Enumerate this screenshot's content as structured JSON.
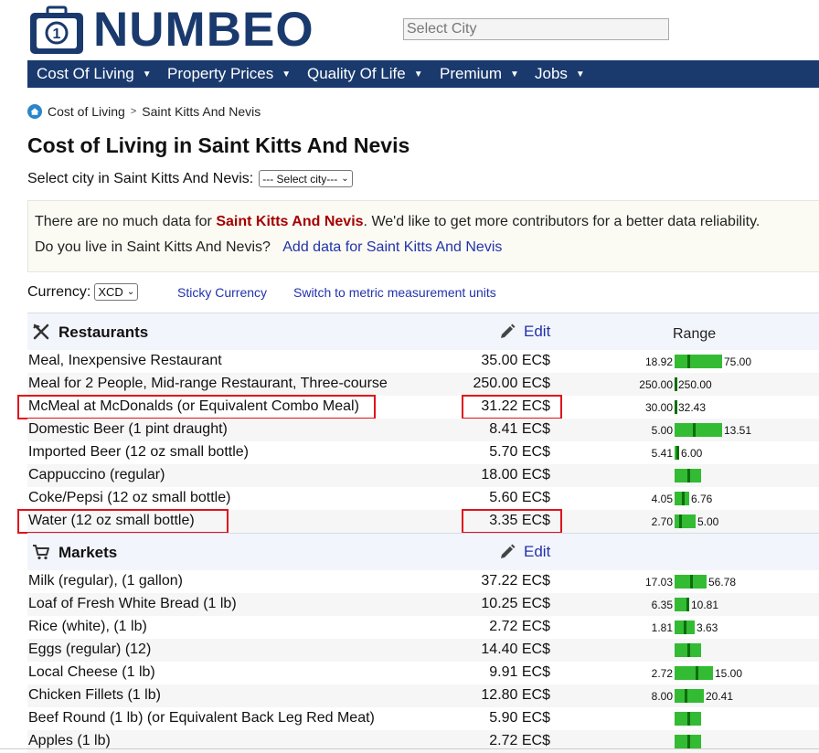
{
  "header": {
    "logo_text": "NUMBEO",
    "search_placeholder": "Select City",
    "nav": [
      {
        "label": "Cost Of Living"
      },
      {
        "label": "Property Prices"
      },
      {
        "label": "Quality Of Life"
      },
      {
        "label": "Premium"
      },
      {
        "label": "Jobs"
      }
    ]
  },
  "breadcrumb": {
    "root": "Cost of Living",
    "separator": ">",
    "current": "Saint Kitts And Nevis"
  },
  "page": {
    "title": "Cost of Living in Saint Kitts And Nevis",
    "select_city_label": "Select city in Saint Kitts And Nevis:",
    "select_city_value": "--- Select city---"
  },
  "notice": {
    "line1_prefix": "There are no much data for ",
    "line1_country": "Saint Kitts And Nevis",
    "line1_suffix": ". We'd like to get more contributors for a better data reliability.",
    "line2_prefix": "Do you live in Saint Kitts And Nevis?",
    "line2_link": "Add data for Saint Kitts And Nevis"
  },
  "currency": {
    "label": "Currency:",
    "value": "XCD",
    "sticky_link": "Sticky Currency",
    "metric_link": "Switch to metric measurement units"
  },
  "colors": {
    "nav_bg": "#1a3a6e",
    "bar": "#33bb33",
    "bar_tick": "#0b6e0b",
    "highlight": "#e0131c",
    "link": "#2233aa"
  },
  "categories": [
    {
      "name": "Restaurants",
      "icon": "fork-knife-icon",
      "edit_label": "Edit",
      "range_label": "Range",
      "rows": [
        {
          "item": "Meal, Inexpensive Restaurant",
          "price": "35.00 EC$",
          "min": "18.92",
          "max": "75.00",
          "bar_fraction": 0.45,
          "tick_fraction": 0.28
        },
        {
          "item": "Meal for 2 People, Mid-range Restaurant, Three-course",
          "price": "250.00 EC$",
          "min": "250.00",
          "max": "250.00",
          "bar_fraction": 0.02,
          "tick_fraction": 0.5
        },
        {
          "item": "McMeal at McDonalds (or Equivalent Combo Meal)",
          "price": "31.22 EC$",
          "min": "30.00",
          "max": "32.43",
          "bar_fraction": 0.02,
          "tick_fraction": 0.5,
          "highlight": true
        },
        {
          "item": "Domestic Beer (1 pint draught)",
          "price": "8.41 EC$",
          "min": "5.00",
          "max": "13.51",
          "bar_fraction": 0.45,
          "tick_fraction": 0.4
        },
        {
          "item": "Imported Beer (12 oz small bottle)",
          "price": "5.70 EC$",
          "min": "5.41",
          "max": "6.00",
          "bar_fraction": 0.04,
          "tick_fraction": 0.5
        },
        {
          "item": "Cappuccino (regular)",
          "price": "18.00 EC$",
          "min": "",
          "max": "",
          "bar_fraction": 0.25,
          "tick_fraction": 0.5
        },
        {
          "item": "Coke/Pepsi (12 oz small bottle)",
          "price": "5.60 EC$",
          "min": "4.05",
          "max": "6.76",
          "bar_fraction": 0.14,
          "tick_fraction": 0.57
        },
        {
          "item": "Water (12 oz small bottle)",
          "price": "3.35 EC$",
          "min": "2.70",
          "max": "5.00",
          "bar_fraction": 0.2,
          "tick_fraction": 0.28,
          "highlight": true
        }
      ]
    },
    {
      "name": "Markets",
      "icon": "shopping-cart-icon",
      "edit_label": "Edit",
      "range_label": "",
      "rows": [
        {
          "item": "Milk (regular), (1 gallon)",
          "price": "37.22 EC$",
          "min": "17.03",
          "max": "56.78",
          "bar_fraction": 0.3,
          "tick_fraction": 0.5
        },
        {
          "item": "Loaf of Fresh White Bread (1 lb)",
          "price": "10.25 EC$",
          "min": "6.35",
          "max": "10.81",
          "bar_fraction": 0.14,
          "tick_fraction": 0.85
        },
        {
          "item": "Rice (white), (1 lb)",
          "price": "2.72 EC$",
          "min": "1.81",
          "max": "3.63",
          "bar_fraction": 0.19,
          "tick_fraction": 0.5
        },
        {
          "item": "Eggs (regular) (12)",
          "price": "14.40 EC$",
          "min": "",
          "max": "",
          "bar_fraction": 0.25,
          "tick_fraction": 0.5
        },
        {
          "item": "Local Cheese (1 lb)",
          "price": "9.91 EC$",
          "min": "2.72",
          "max": "15.00",
          "bar_fraction": 0.36,
          "tick_fraction": 0.58
        },
        {
          "item": "Chicken Fillets (1 lb)",
          "price": "12.80 EC$",
          "min": "8.00",
          "max": "20.41",
          "bar_fraction": 0.28,
          "tick_fraction": 0.38
        },
        {
          "item": "Beef Round (1 lb) (or Equivalent Back Leg Red Meat)",
          "price": "5.90 EC$",
          "min": "",
          "max": "",
          "bar_fraction": 0.25,
          "tick_fraction": 0.5
        },
        {
          "item": "Apples (1 lb)",
          "price": "2.72 EC$",
          "min": "",
          "max": "",
          "bar_fraction": 0.25,
          "tick_fraction": 0.5
        }
      ]
    }
  ]
}
